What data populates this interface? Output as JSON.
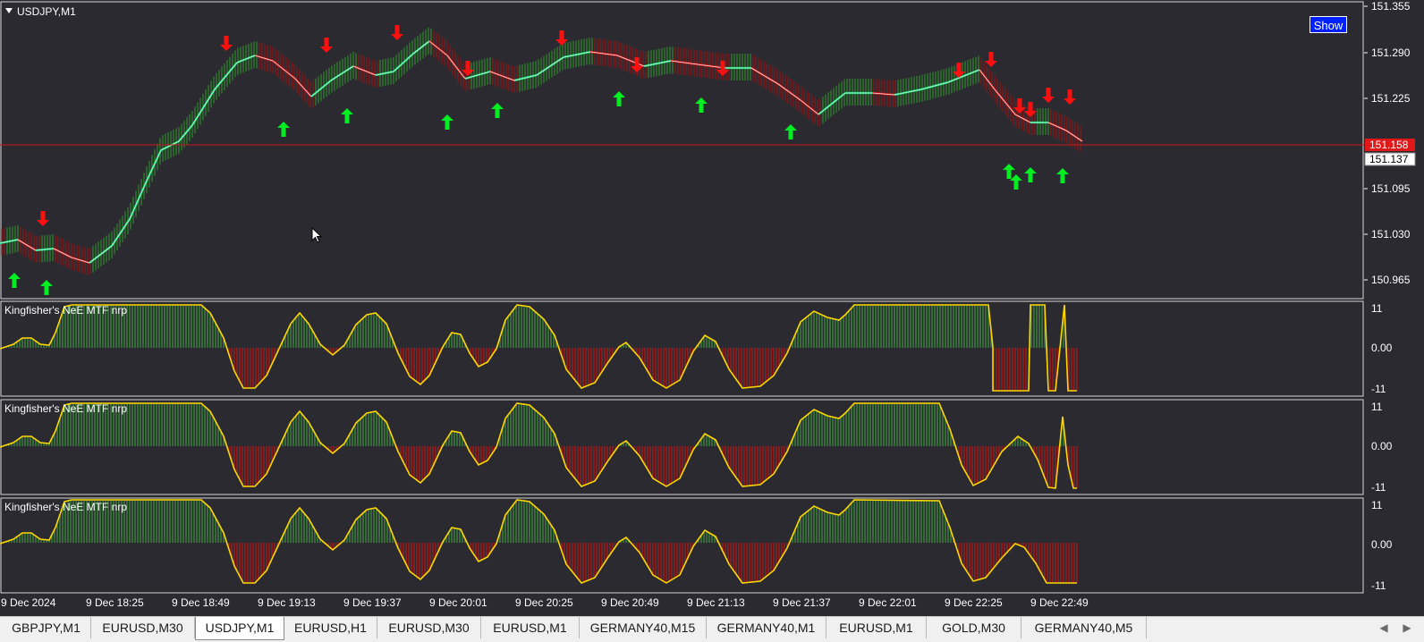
{
  "main_chart": {
    "title": "USDJPY,M1",
    "show_button": "Show",
    "price_labels": [
      "151.355",
      "151.290",
      "151.225",
      "151.095",
      "151.030",
      "150.965"
    ],
    "ask_price": "151.158",
    "bid_price": "151.137"
  },
  "subpanels": [
    {
      "title": "Kingfisher's NeE MTF nrp",
      "scale": [
        "11",
        "0.00",
        "-11"
      ]
    },
    {
      "title": "Kingfisher's NeE MTF nrp",
      "scale": [
        "11",
        "0.00",
        "-11"
      ]
    },
    {
      "title": "Kingfisher's NeE MTF nrp",
      "scale": [
        "11",
        "0.00",
        "-11"
      ]
    }
  ],
  "time_axis": [
    "9 Dec 2024",
    "9 Dec 18:25",
    "9 Dec 18:49",
    "9 Dec 19:13",
    "9 Dec 19:37",
    "9 Dec 20:01",
    "9 Dec 20:25",
    "9 Dec 20:49",
    "9 Dec 21:13",
    "9 Dec 21:37",
    "9 Dec 22:01",
    "9 Dec 22:25",
    "9 Dec 22:49"
  ],
  "tabs": [
    "GBPJPY,M1",
    "EURUSD,M30",
    "USDJPY,M1",
    "EURUSD,H1",
    "EURUSD,M30",
    "EURUSD,M1",
    "GERMANY40,M15",
    "GERMANY40,M1",
    "EURUSD,M1",
    "GOLD,M30",
    "GERMANY40,M5"
  ],
  "active_tab": "USDJPY,M1",
  "colors": {
    "background": "#2a2a30",
    "bull": "#00e070",
    "bear": "#e01818",
    "arrow_up": "#00ee22",
    "arrow_down": "#ff1010",
    "oscillator_line": "#ffd700",
    "histogram_up": "#3c8c3c",
    "histogram_down": "#b01818",
    "ask_line": "#c81818",
    "show_button": "#0020ff"
  },
  "icons": {
    "collapse": "triangle-down-icon",
    "scroll_left": "chevron-left-icon",
    "scroll_right": "chevron-right-icon",
    "cursor": "mouse-pointer-icon"
  }
}
